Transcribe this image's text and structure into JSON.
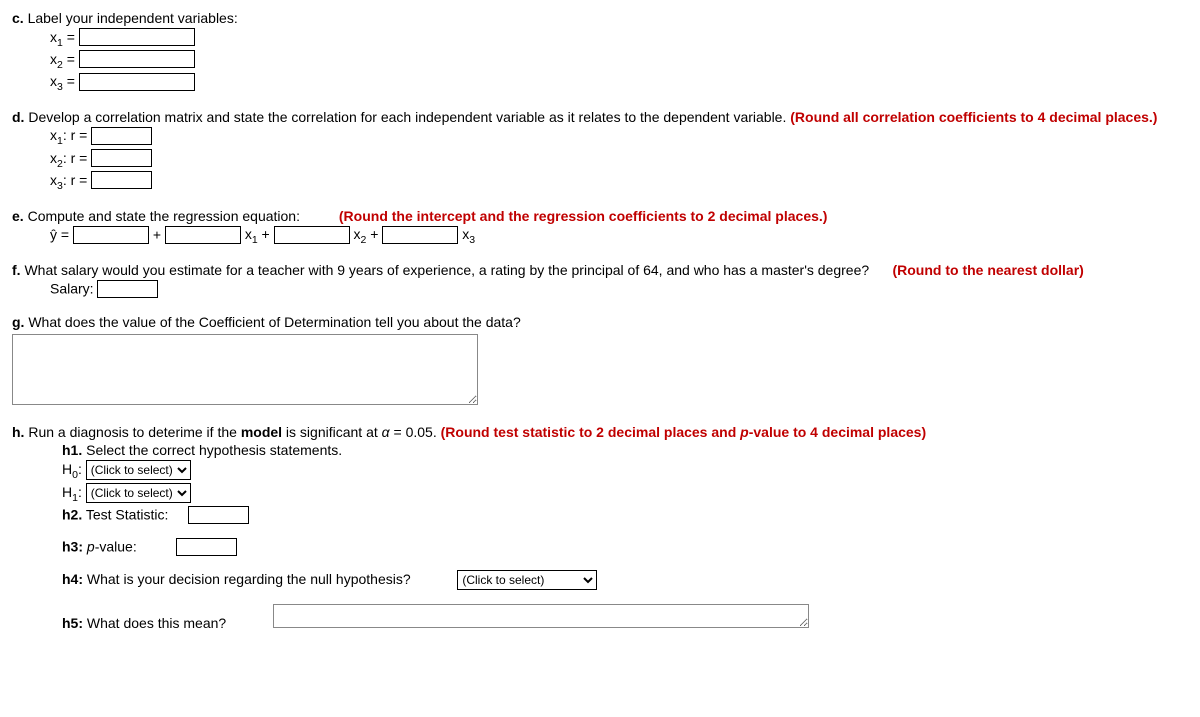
{
  "c": {
    "prompt": "Label your independent variables:",
    "x1_label": "x",
    "x1_sub": "1",
    "eq": " = ",
    "x2_label": "x",
    "x2_sub": "2",
    "x3_label": "x",
    "x3_sub": "3"
  },
  "d": {
    "prompt_a": "Develop a correlation matrix and state the correlation for each independent variable as it relates to the dependent variable.",
    "round": "(Round all correlation coefficients to 4 decimal places.)",
    "x1": "x",
    "x1_sub": "1",
    "x1_tail": ": r = ",
    "x2": "x",
    "x2_sub": "2",
    "x2_tail": ": r = ",
    "x3": "x",
    "x3_sub": "3",
    "x3_tail": ": r = "
  },
  "e": {
    "prompt": "Compute and state the regression equation:",
    "round": "(Round the intercept and the regression coefficients to 2 decimal places.)",
    "yhat": "ŷ = ",
    "plus": " + ",
    "x1": " x",
    "x1_sub": "1",
    "x1_plus": " + ",
    "x2": " x",
    "x2_sub": "2",
    "x2_plus": " + ",
    "x3": " x",
    "x3_sub": "3"
  },
  "f": {
    "prompt_a": "What salary would you estimate for a teacher with 9 years of experience, a rating by the principal of 64, and who has a master's degree?",
    "round": "(Round to the nearest dollar)",
    "salary_label": "Salary: "
  },
  "g": {
    "prompt": "What does the value of the Coefficient of Determination tell you about the data?"
  },
  "h": {
    "prompt_a": "Run a diagnosis to deterime if the ",
    "prompt_bold": "model",
    "prompt_b": " is significant at ",
    "alpha": "α",
    "prompt_c": " = 0.05. ",
    "round": "(Round test statistic to 2 decimal places and ",
    "p_italic": "p",
    "round_b": "-value to 4 decimal places)",
    "h1_label": "h1.",
    "h1_text": " Select the correct hypothesis statements.",
    "h0_label": "H",
    "h0_sub": "0",
    "h0_colon": ": ",
    "h1b_label": "H",
    "h1b_sub": "1",
    "h1b_colon": ": ",
    "h2_label": "h2.",
    "h2_text": " Test Statistic: ",
    "h3_label": "h3:",
    "h3_text": " ",
    "h3_p": "p",
    "h3_tail": "-value:",
    "h4_label": "h4:",
    "h4_text": " What is your decision regarding the null hypothesis?",
    "h5_label": "h5:",
    "h5_text": " What does this mean?",
    "select_placeholder": "(Click to select)"
  },
  "letters": {
    "c": "c. ",
    "d": "d. ",
    "e": "e. ",
    "f": "f.  ",
    "g": "g. ",
    "h": "h. "
  }
}
